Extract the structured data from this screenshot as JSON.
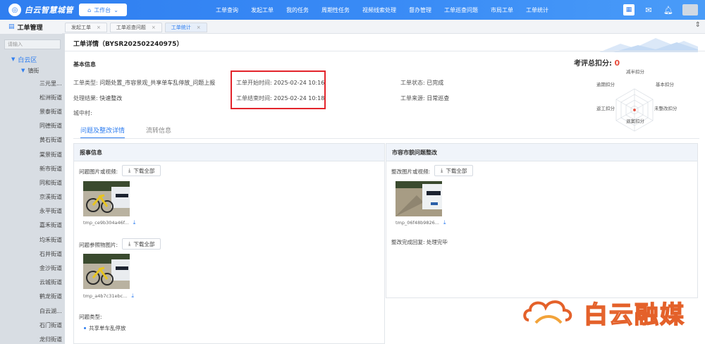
{
  "header": {
    "app_name": "白云智慧城管",
    "workbench_label": "工作台",
    "nav": [
      "工单查询",
      "发起工单",
      "我的任务",
      "周期性任务",
      "视频线索处理",
      "督办管理",
      "工单巡查问题",
      "市局工单",
      "工单统计"
    ]
  },
  "module": {
    "title": "工单管理"
  },
  "tabs": [
    {
      "label": "发起工单",
      "active": false
    },
    {
      "label": "工单巡查问题",
      "active": false
    },
    {
      "label": "工单统计",
      "active": true
    }
  ],
  "sidebar": {
    "search_placeholder": "请输入",
    "root": "白云区",
    "sub": "镇街",
    "items": [
      "三元里...",
      "松洲街道",
      "景泰街道",
      "同德街道",
      "黄石街道",
      "棠景街道",
      "新市街道",
      "同和街道",
      "京溪街道",
      "永平街道",
      "嘉禾街道",
      "均禾街道",
      "石井街道",
      "金沙街道",
      "云城街道",
      "鹤龙街道",
      "白云湖...",
      "石门街道",
      "龙归街道"
    ]
  },
  "detail": {
    "title": "工单详情（BYSR202502240975）",
    "basic_info_title": "基本信息",
    "score_label": "考评总扣分:",
    "score_value": "0",
    "fields": {
      "type_label": "工单类型:",
      "type_value": "问题处置_市容景观_共享单车乱停放_问题上报",
      "start_label": "工单开始时间:",
      "start_value": "2025-02-24 10:16",
      "status_label": "工单状态:",
      "status_value": "已完成",
      "result_label": "处理结果:",
      "result_value": "快速整改",
      "end_label": "工单结束时间:",
      "end_value": "2025-02-24 10:18",
      "source_label": "工单来源:",
      "source_value": "日常巡查",
      "village_label": "城中村:",
      "village_value": ""
    },
    "radar_labels": {
      "top": "减半扣分",
      "top_right": "基本扣分",
      "right": "未整改扣分",
      "bottom": "退案扣分",
      "left": "返工扣分",
      "top_left": "逾期扣分"
    },
    "subtabs": [
      "问题及整改详情",
      "流转信息"
    ],
    "left_panel": {
      "title": "报事信息",
      "media_label": "问题图片或视频:",
      "download_all": "下载全部",
      "file1": "tmp_ce9b304a46f...",
      "ref_label": "问题参照物图片:",
      "file2": "tmp_a4b7c31ebc...",
      "problem_type_label": "问题类型:",
      "problem_type_value": "共享单车乱停放"
    },
    "right_panel": {
      "title": "市容市貌问题整改",
      "media_label": "整改图片或视频:",
      "download_all": "下载全部",
      "file1": "tmp_06f48b9826...",
      "reply_label": "整改完成回复:",
      "reply_value": "处理完毕"
    }
  },
  "watermark": "白云融媒",
  "colors": {
    "brand": "#2f7ef0",
    "highlight": "#e3242b",
    "score": "#e74c3c"
  }
}
